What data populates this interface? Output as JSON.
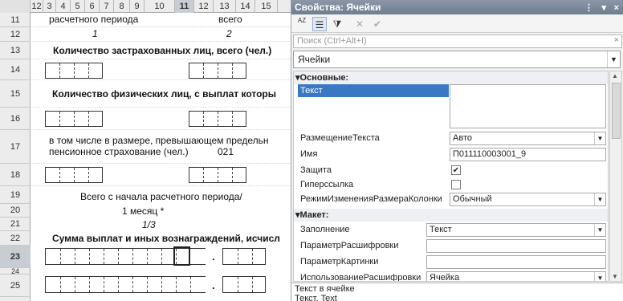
{
  "sheet": {
    "col_headers": [
      "12",
      "3",
      "4",
      "5",
      "6",
      "7",
      "8",
      "9",
      "10",
      "11",
      "12",
      "13",
      "14",
      "15"
    ],
    "selected_col": "11",
    "row_headers": [
      "11",
      "12",
      "13",
      "14",
      "15",
      "16",
      "17",
      "18",
      "19",
      "20",
      "21",
      "22",
      "23",
      "24",
      "25"
    ],
    "selected_row": "23",
    "cells": {
      "r11_a": "расчетного периода",
      "r11_b": "всего",
      "r12_a": "1",
      "r12_b": "2",
      "r13": "Количество застрахованных лиц, всего (чел.)",
      "r15": "Количество физических лиц, с выплат которы",
      "r17_l1": "в том числе в размере, превышающем предельн",
      "r17_l2": "пенсионное страхование (чел.)",
      "r17_code": "021",
      "r19": "Всего с начала расчетного периода/",
      "r20": "1 месяц *",
      "r21": "1/3",
      "r22": "Сумма выплат и иных вознаграждений, исчисл"
    }
  },
  "panel": {
    "title": "Свойства: Ячейки",
    "title_controls": [
      "⋮",
      "▾",
      "×"
    ],
    "toolbar": {
      "sort_alpha": "AZ",
      "categories": "☰",
      "filter": "⧩",
      "clear": "✕",
      "apply": "✔"
    },
    "search_placeholder": "Поиск (Ctrl+Alt+I)",
    "search_clear": "×",
    "object_selector": "Ячейки",
    "groups": {
      "basic": "Основные:",
      "layout": "Макет:"
    },
    "props": {
      "text_label": "Текст",
      "text_value": "",
      "placement_label": "РазмещениеТекста",
      "placement_value": "Авто",
      "name_label": "Имя",
      "name_value": "П011110003001_9",
      "protection_label": "Защита",
      "protection_checked": "✔",
      "hyperlink_label": "Гиперссылка",
      "hyperlink_checked": "",
      "colresize_label": "РежимИзмененияРазмераКолонки",
      "colresize_value": "Обычный",
      "fill_label": "Заполнение",
      "fill_value": "Текст",
      "decode_param_label": "ПараметрРасшифровки",
      "decode_param_value": "",
      "picture_param_label": "ПараметрКартинки",
      "picture_param_value": "",
      "decode_use_label": "ИспользованиеРасшифровки",
      "decode_use_value": "Ячейка"
    },
    "description": {
      "line1": "Текст в ячейке",
      "line2": "Текст, Text"
    }
  }
}
